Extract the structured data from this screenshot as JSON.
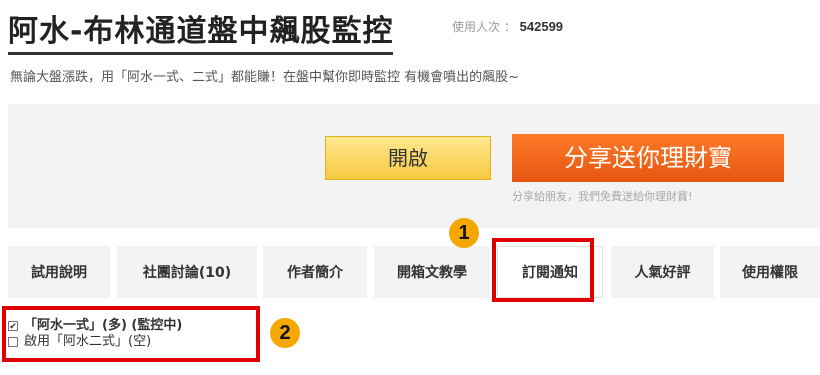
{
  "header": {
    "title": "阿水-布林通道盤中飆股監控",
    "usage_label": "使用人次 ：",
    "usage_count": "542599"
  },
  "subtitle": "無論大盤漲跌，用「阿水一式、二式」都能賺！在盤中幫你即時監控 有機會噴出的飆股~",
  "actions": {
    "open_label": "開啟",
    "share_label": "分享送你理財寶",
    "share_note": "分享給朋友，我們免費送給你理財寶!"
  },
  "tabs": [
    {
      "label": "試用說明"
    },
    {
      "label": "社團討論(10)"
    },
    {
      "label": "作者簡介"
    },
    {
      "label": "開箱文教學"
    },
    {
      "label": "訂閱通知"
    },
    {
      "label": "人氣好評"
    },
    {
      "label": "使用權限"
    }
  ],
  "active_tab": "訂閱通知",
  "options": [
    {
      "label": "「阿水一式」(多) (監控中)",
      "checked": true
    },
    {
      "label": "啟用「阿水二式」(空)",
      "checked": false
    }
  ],
  "annotations": {
    "marker_1": "1",
    "marker_2": "2",
    "highlight_color": "#e00000",
    "marker_color": "#f6a800"
  },
  "colors": {
    "open_button": "#f6c940",
    "share_button": "#e65510"
  }
}
